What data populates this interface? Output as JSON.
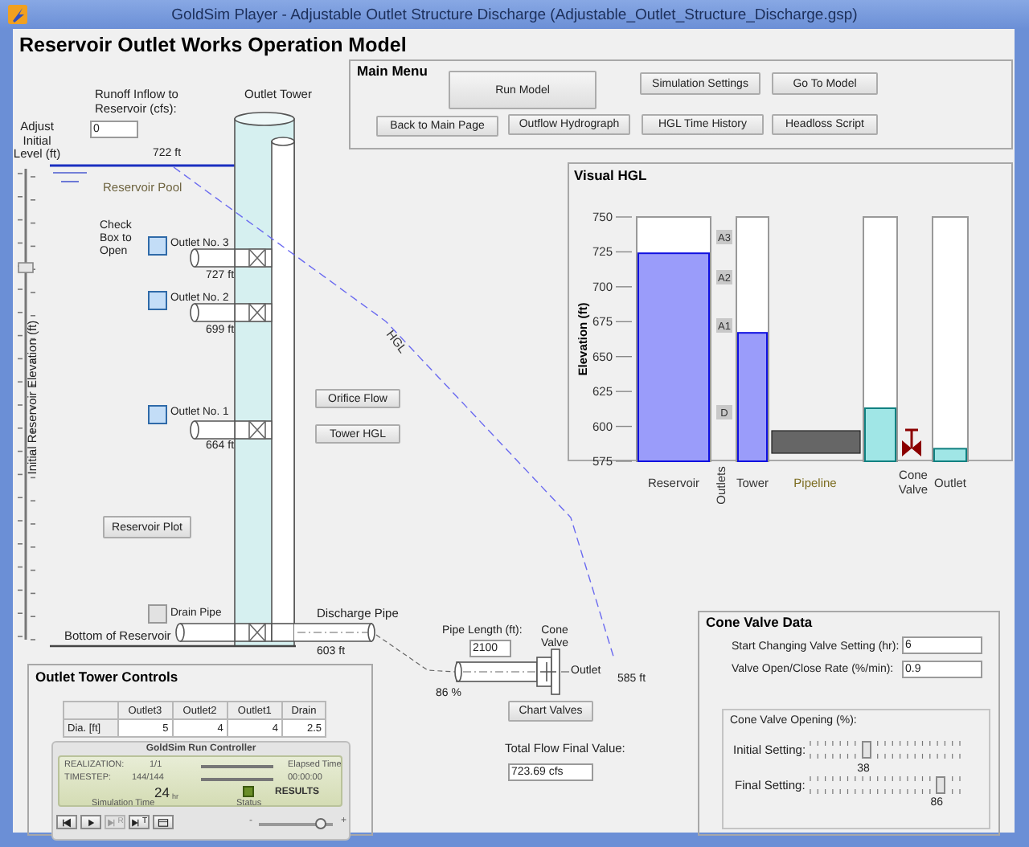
{
  "window": {
    "title": "GoldSim Player - Adjustable Outlet Structure Discharge (Adjustable_Outlet_Structure_Discharge.gsp)"
  },
  "heading": "Reservoir Outlet Works Operation Model",
  "main_menu": {
    "title": "Main Menu",
    "buttons": [
      {
        "label": "Run Model"
      },
      {
        "label": "Simulation Settings"
      },
      {
        "label": "Go To Model"
      },
      {
        "label": "Back to Main Page"
      },
      {
        "label": "Outflow Hydrograph"
      },
      {
        "label": "HGL Time History"
      },
      {
        "label": "Headloss Script"
      }
    ]
  },
  "level_slider": {
    "label": "Adjust Initial Level (ft)",
    "axis_label": "Initial Reservoir Elevation (ft)",
    "level": 0.79
  },
  "runoff": {
    "label": "Runoff Inflow to Reservoir (cfs):",
    "value": "0"
  },
  "schematic": {
    "tower_label": "Outlet Tower",
    "pool_level": "722 ft",
    "pool_label": "Reservoir Pool",
    "check_hint": "Check Box to Open",
    "outlets": [
      {
        "label": "Outlet No. 3",
        "checked": true,
        "elevation": "727 ft"
      },
      {
        "label": "Outlet No. 2",
        "checked": true,
        "elevation": "699 ft"
      },
      {
        "label": "Outlet No. 1",
        "checked": true,
        "elevation": "664 ft"
      },
      {
        "label": "Drain Pipe",
        "checked": false,
        "elevation": "603 ft"
      }
    ],
    "discharge_label": "Discharge Pipe",
    "bottom_label": "Bottom of Reservoir",
    "hgl_label": "HGL",
    "buttons": [
      {
        "label": "Orifice Flow"
      },
      {
        "label": "Tower HGL"
      },
      {
        "label": "Reservoir Plot"
      }
    ]
  },
  "pipeline": {
    "length_label": "Pipe Length (ft):",
    "length": "2100",
    "valve_label": "Cone Valve",
    "valve_opening": "86 %",
    "outlet_label": "Outlet",
    "outlet_elevation": "585 ft",
    "chart_button": "Chart Valves",
    "total_flow_label": "Total Flow Final Value:",
    "total_flow": "723.69 cfs"
  },
  "visual_hgl": {
    "title": "Visual HGL",
    "outlets_label": "Outlets",
    "outlet_tags": [
      "A3",
      "A2",
      "A1",
      "D"
    ],
    "chart_data": {
      "type": "bar",
      "ylabel": "Elevation (ft)",
      "categories": [
        "Reservoir",
        "Tower",
        "Pipeline",
        "Cone Valve",
        "Outlet"
      ],
      "ylim": [
        575,
        750
      ],
      "yticks": [
        575,
        600,
        625,
        650,
        675,
        700,
        725,
        750
      ],
      "series": [
        {
          "color": "#9a9cfa",
          "values": [
            724,
            667,
            null,
            null,
            null
          ]
        },
        {
          "color": "#a0e6e6",
          "values": [
            null,
            null,
            null,
            613,
            584
          ]
        }
      ]
    }
  },
  "cone_valve_data": {
    "title": "Cone Valve Data",
    "fields": [
      {
        "label": "Start Changing Valve Setting (hr):",
        "value": "6"
      },
      {
        "label": "Valve Open/Close Rate (%/min):",
        "value": "0.9"
      }
    ],
    "opening": {
      "title": "Cone Valve Opening (%):",
      "sliders": [
        {
          "label": "Initial Setting:",
          "level": 0.38,
          "reading": "38"
        },
        {
          "label": "Final Setting:",
          "level": 0.86,
          "reading": "86"
        }
      ]
    }
  },
  "outlet_tower_controls": {
    "title": "Outlet Tower Controls",
    "table": {
      "columns": [
        "Outlet3",
        "Outlet2",
        "Outlet1",
        "Drain"
      ],
      "rows": [
        {
          "label": "Dia. [ft]",
          "cells": [
            "5",
            "4",
            "4",
            "2.5"
          ]
        }
      ]
    }
  },
  "run_controller": {
    "title": "GoldSim Run Controller",
    "realization_label": "REALIZATION:",
    "realization": "1/1",
    "timestep_label": "TIMESTEP:",
    "timestep": "144/144",
    "progress_bars": [
      {
        "level": 1
      },
      {
        "level": 1
      }
    ],
    "elapsed_label": "Elapsed Time",
    "elapsed": "00:00:00",
    "sim_time": "24",
    "sim_time_unit": "hr",
    "sim_time_label": "Simulation Time",
    "status_label": "Status",
    "status_text": "RESULTS",
    "buttons": [
      {
        "kind": "first",
        "disabled": false
      },
      {
        "kind": "play",
        "disabled": false
      },
      {
        "kind": "step",
        "label": "R",
        "disabled": true
      },
      {
        "kind": "step",
        "label": "T",
        "disabled": false
      },
      {
        "kind": "screen",
        "disabled": false
      }
    ],
    "speed": {
      "minus": "-",
      "plus": "+",
      "level": 0.82
    }
  }
}
